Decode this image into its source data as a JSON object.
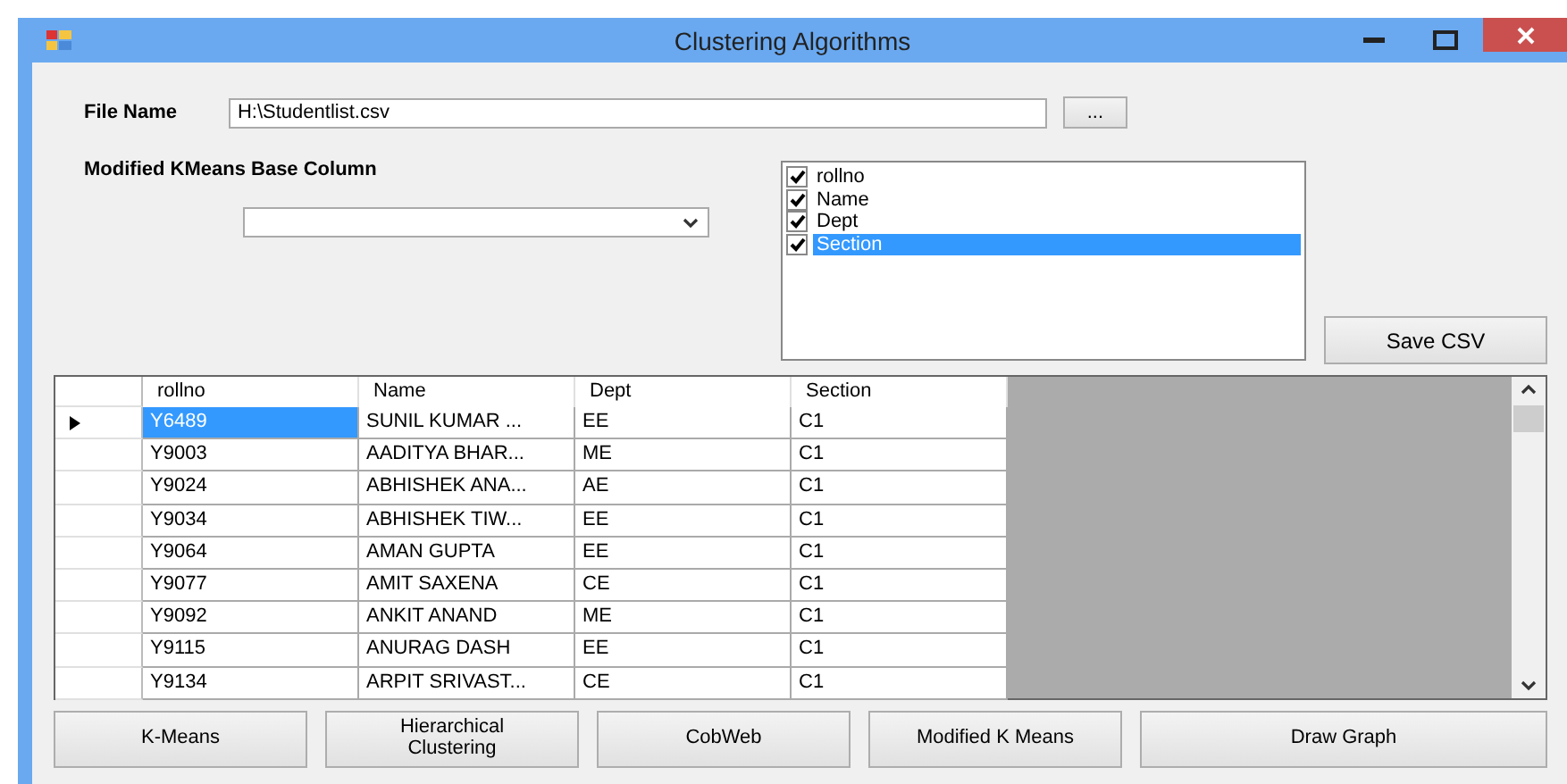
{
  "window": {
    "title": "Clustering Algorithms"
  },
  "file_name": {
    "label": "File Name",
    "value": "H:\\Studentlist.csv"
  },
  "browse_button": "...",
  "base_column": {
    "label": "Modified KMeans Base Column"
  },
  "columns_list": [
    {
      "label": "rollno",
      "checked": true,
      "selected": false
    },
    {
      "label": "Name",
      "checked": true,
      "selected": false
    },
    {
      "label": "Dept",
      "checked": true,
      "selected": false
    },
    {
      "label": "Section",
      "checked": true,
      "selected": true
    }
  ],
  "save_button": "Save CSV",
  "table": {
    "columns": [
      "rollno",
      "Name",
      "Dept",
      "Section"
    ],
    "rows": [
      {
        "cells": [
          "Y6489",
          "SUNIL KUMAR ...",
          "EE",
          "C1"
        ],
        "selected": true
      },
      {
        "cells": [
          "Y9003",
          "AADITYA BHAR...",
          "ME",
          "C1"
        ],
        "selected": false
      },
      {
        "cells": [
          "Y9024",
          "ABHISHEK ANA...",
          "AE",
          "C1"
        ],
        "selected": false
      },
      {
        "cells": [
          "Y9034",
          "ABHISHEK TIW...",
          "EE",
          "C1"
        ],
        "selected": false
      },
      {
        "cells": [
          "Y9064",
          "AMAN GUPTA",
          "EE",
          "C1"
        ],
        "selected": false
      },
      {
        "cells": [
          "Y9077",
          "AMIT SAXENA",
          "CE",
          "C1"
        ],
        "selected": false
      },
      {
        "cells": [
          "Y9092",
          "ANKIT ANAND",
          "ME",
          "C1"
        ],
        "selected": false
      },
      {
        "cells": [
          "Y9115",
          "ANURAG DASH",
          "EE",
          "C1"
        ],
        "selected": false
      },
      {
        "cells": [
          "Y9134",
          "ARPIT SRIVAST...",
          "CE",
          "C1"
        ],
        "selected": false
      }
    ]
  },
  "buttons": [
    {
      "label": "K-Means",
      "kind": "normal"
    },
    {
      "label": "Hierarchical Clustering",
      "kind": "normal"
    },
    {
      "label": "CobWeb",
      "kind": "normal"
    },
    {
      "label": "Modified K Means",
      "kind": "normal"
    },
    {
      "label": "Draw Graph",
      "kind": "wide"
    }
  ]
}
